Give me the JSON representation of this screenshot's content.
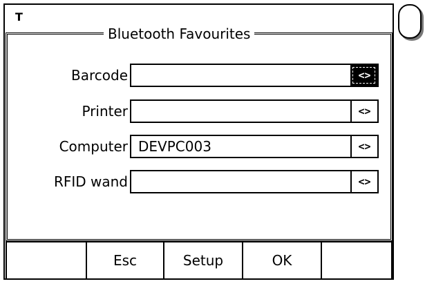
{
  "top_marker": "T",
  "dialog": {
    "title": "Bluetooth Favourites"
  },
  "fields": [
    {
      "label": "Barcode",
      "value": "",
      "picker": "<>",
      "picker_active": true
    },
    {
      "label": "Printer",
      "value": "",
      "picker": "<>",
      "picker_active": false
    },
    {
      "label": "Computer",
      "value": "DEVPC003",
      "picker": "<>",
      "picker_active": false
    },
    {
      "label": "RFID wand",
      "value": "",
      "picker": "<>",
      "picker_active": false
    }
  ],
  "softkeys": {
    "slot1": "",
    "esc": "Esc",
    "setup": "Setup",
    "ok": "OK",
    "slot5": ""
  },
  "colors": {
    "foreground": "#000000",
    "background": "#ffffff",
    "corner_shadow": "#777777"
  },
  "icons": {
    "corner": "rounded-square-button-icon"
  }
}
